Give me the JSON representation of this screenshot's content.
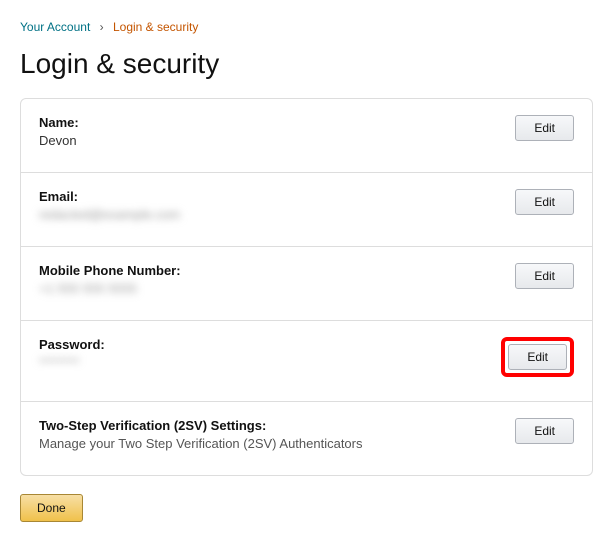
{
  "breadcrumb": {
    "link_text": "Your Account",
    "separator": "›",
    "current": "Login & security"
  },
  "page_title": "Login & security",
  "rows": {
    "name": {
      "label": "Name:",
      "value": "Devon",
      "button": "Edit"
    },
    "email": {
      "label": "Email:",
      "value": "redacted@example.com",
      "button": "Edit"
    },
    "phone": {
      "label": "Mobile Phone Number:",
      "value": "+1 555 555 5555",
      "button": "Edit"
    },
    "password": {
      "label": "Password:",
      "value": "********",
      "button": "Edit"
    },
    "two_step": {
      "label": "Two-Step Verification (2SV) Settings:",
      "desc": "Manage your Two Step Verification (2SV) Authenticators",
      "button": "Edit"
    }
  },
  "done_button": "Done"
}
